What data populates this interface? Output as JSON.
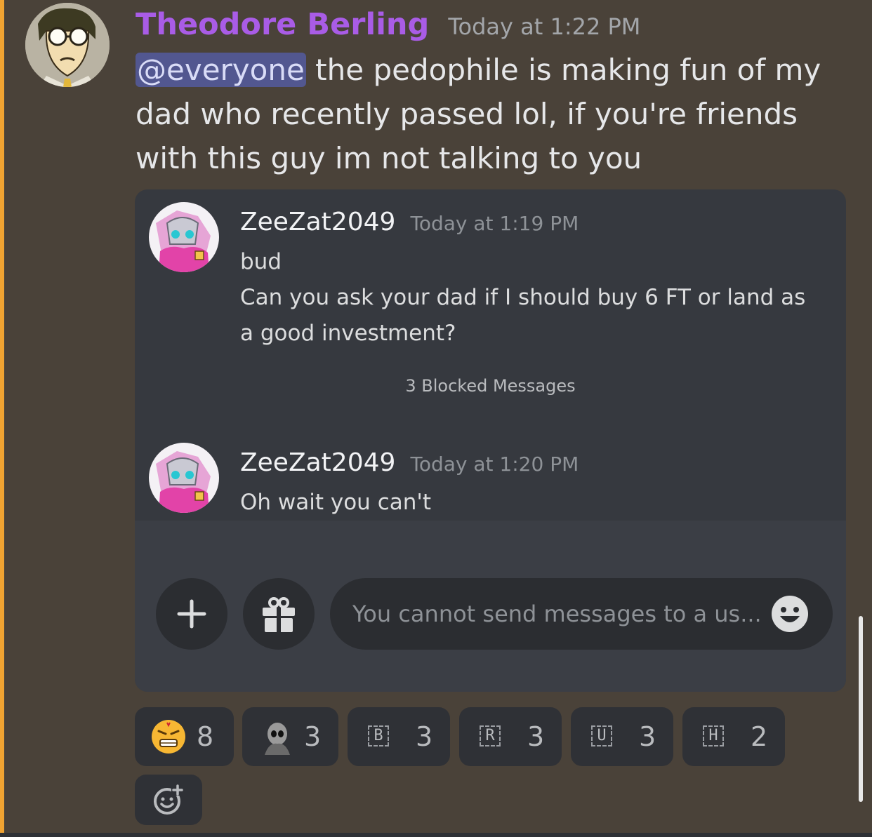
{
  "message": {
    "author": "Theodore Berling",
    "timestamp": "Today at 1:22 PM",
    "mention": "@everyone",
    "text": " the pedophile is making fun of my dad who recently passed lol, if you're friends with this guy im not talking to you",
    "avatar_icon": "cartoon-man-glasses-avatar"
  },
  "embedded_screenshot": {
    "messages": [
      {
        "author": "ZeeZat2049",
        "timestamp": "Today at 1:19 PM",
        "lines": [
          "bud",
          "Can you ask your dad if I should buy 6 FT or land as a good investment?"
        ],
        "avatar_icon": "pink-robot-avatar"
      },
      {
        "author": "ZeeZat2049",
        "timestamp": "Today at 1:20 PM",
        "lines": [
          "Oh wait you can't"
        ],
        "avatar_icon": "pink-robot-avatar"
      }
    ],
    "blocked_note": "3 Blocked Messages",
    "composer": {
      "placeholder": "You cannot send messages to a us...",
      "plus_icon": "plus-icon",
      "gift_icon": "gift-icon",
      "emoji_icon": "smiley-icon"
    }
  },
  "reactions": [
    {
      "emoji": "angry-face-emoji",
      "count": "8"
    },
    {
      "emoji": "dark-figure-emoji",
      "count": "3"
    },
    {
      "emoji": "B",
      "count": "3"
    },
    {
      "emoji": "R",
      "count": "3"
    },
    {
      "emoji": "U",
      "count": "3"
    },
    {
      "emoji": "H",
      "count": "2"
    }
  ],
  "colors": {
    "background": "#4a4239",
    "accent_bar": "#f0a332",
    "author_name": "#a95ce6",
    "mention_bg": "#525790",
    "card_bg": "#36393f",
    "reaction_bg": "#2f3136"
  }
}
